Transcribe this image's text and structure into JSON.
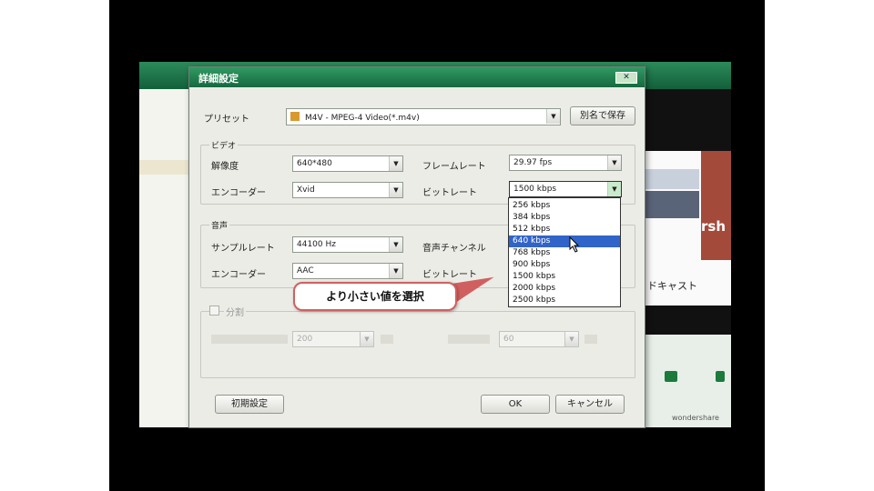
{
  "background_app": {
    "side_text_1": "ドキャスト",
    "side_text_2": "rsh",
    "brand_text": "wondershare"
  },
  "dialog": {
    "title": "詳細設定",
    "close_label": "✕",
    "preset": {
      "label": "プリセット",
      "value": "M4V - MPEG-4 Video(*.m4v)",
      "save_as_button": "別名で保存"
    },
    "video": {
      "group_label": "ビデオ",
      "resolution_label": "解像度",
      "resolution_value": "640*480",
      "frame_rate_label": "フレームレート",
      "frame_rate_value": "29.97 fps",
      "encoder_label": "エンコーダー",
      "encoder_value": "Xvid",
      "bitrate_label": "ビットレート",
      "bitrate_value": "1500 kbps"
    },
    "audio": {
      "group_label": "音声",
      "sample_rate_label": "サンプルレート",
      "sample_rate_value": "44100 Hz",
      "channel_label": "音声チャンネル",
      "encoder_label": "エンコーダー",
      "encoder_value": "AAC",
      "bitrate_label": "ビットレート"
    },
    "split": {
      "label": "分割",
      "checked": false,
      "size_value": "200",
      "time_value": "60"
    },
    "bitrate_options": [
      "256 kbps",
      "384 kbps",
      "512 kbps",
      "640 kbps",
      "768 kbps",
      "900 kbps",
      "1500 kbps",
      "2000 kbps",
      "2500 kbps"
    ],
    "highlighted_option": "640 kbps",
    "buttons": {
      "reset": "初期設定",
      "ok": "OK",
      "cancel": "キャンセル"
    }
  },
  "annotation": {
    "callout_text": "より小さい値を選択"
  },
  "colors": {
    "title_green": "#16693f",
    "highlight_blue": "#3164c8",
    "callout_border": "#d06060"
  }
}
